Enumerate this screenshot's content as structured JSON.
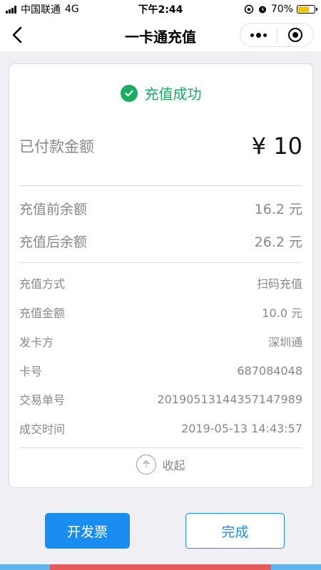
{
  "status_bar": {
    "carrier": "中国联通",
    "network": "4G",
    "time": "下午2:44",
    "battery": "70%",
    "battery_level": 0.7
  },
  "nav": {
    "title": "一卡通充值"
  },
  "result": {
    "status": "充值成功",
    "paid_label": "已付款金额",
    "paid_amount": "¥ 10",
    "balance_before_label": "充值前余额",
    "balance_before_value": "16.2 元",
    "balance_after_label": "充值后余额",
    "balance_after_value": "26.2 元"
  },
  "details": [
    {
      "label": "充值方式",
      "value": "扫码充值"
    },
    {
      "label": "充值金额",
      "value": "10.0 元"
    },
    {
      "label": "发卡方",
      "value": "深圳通"
    },
    {
      "label": "卡号",
      "value": "687084048"
    },
    {
      "label": "交易单号",
      "value": "20190513144357147989"
    },
    {
      "label": "成交时间",
      "value": "2019-05-13 14:43:57"
    }
  ],
  "collapse_label": "收起",
  "buttons": {
    "invoice": "开发票",
    "done": "完成"
  },
  "colors": {
    "success": "#1aad61",
    "primary": "#1a8ef0"
  }
}
